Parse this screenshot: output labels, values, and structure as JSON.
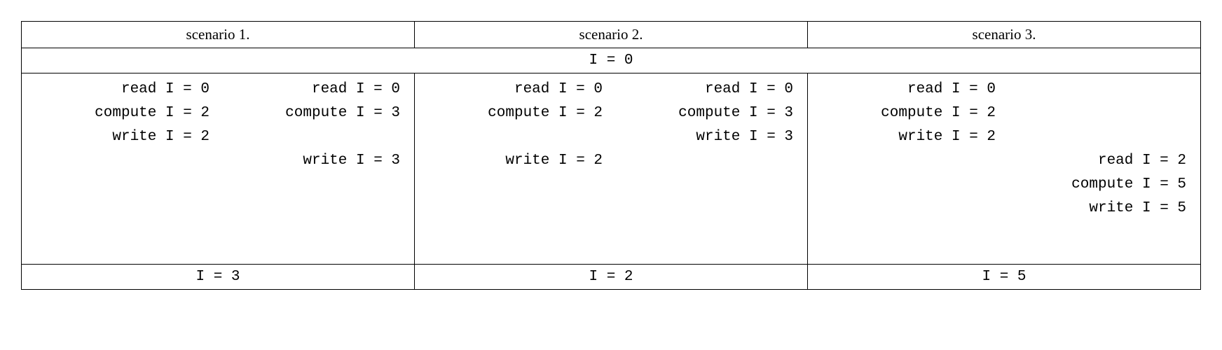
{
  "headers": [
    "scenario 1.",
    "scenario 2.",
    "scenario 3."
  ],
  "init": "I = 0",
  "scenarios": [
    {
      "left": [
        "read I = 0",
        "compute I = 2",
        "write I = 2",
        "",
        "",
        ""
      ],
      "right": [
        "read I = 0",
        "compute I = 3",
        "",
        "write I = 3",
        "",
        ""
      ],
      "result": "I = 3"
    },
    {
      "left": [
        "read I = 0",
        "compute I = 2",
        "",
        "write I = 2",
        "",
        ""
      ],
      "right": [
        "read I = 0",
        "compute I = 3",
        "write I = 3",
        "",
        "",
        ""
      ],
      "result": "I = 2"
    },
    {
      "left": [
        "read I = 0",
        "compute I = 2",
        "write I = 2",
        "",
        "",
        ""
      ],
      "right": [
        "",
        "",
        "",
        "read I = 2",
        "compute I = 5",
        "write I = 5"
      ],
      "result": "I = 5"
    }
  ]
}
